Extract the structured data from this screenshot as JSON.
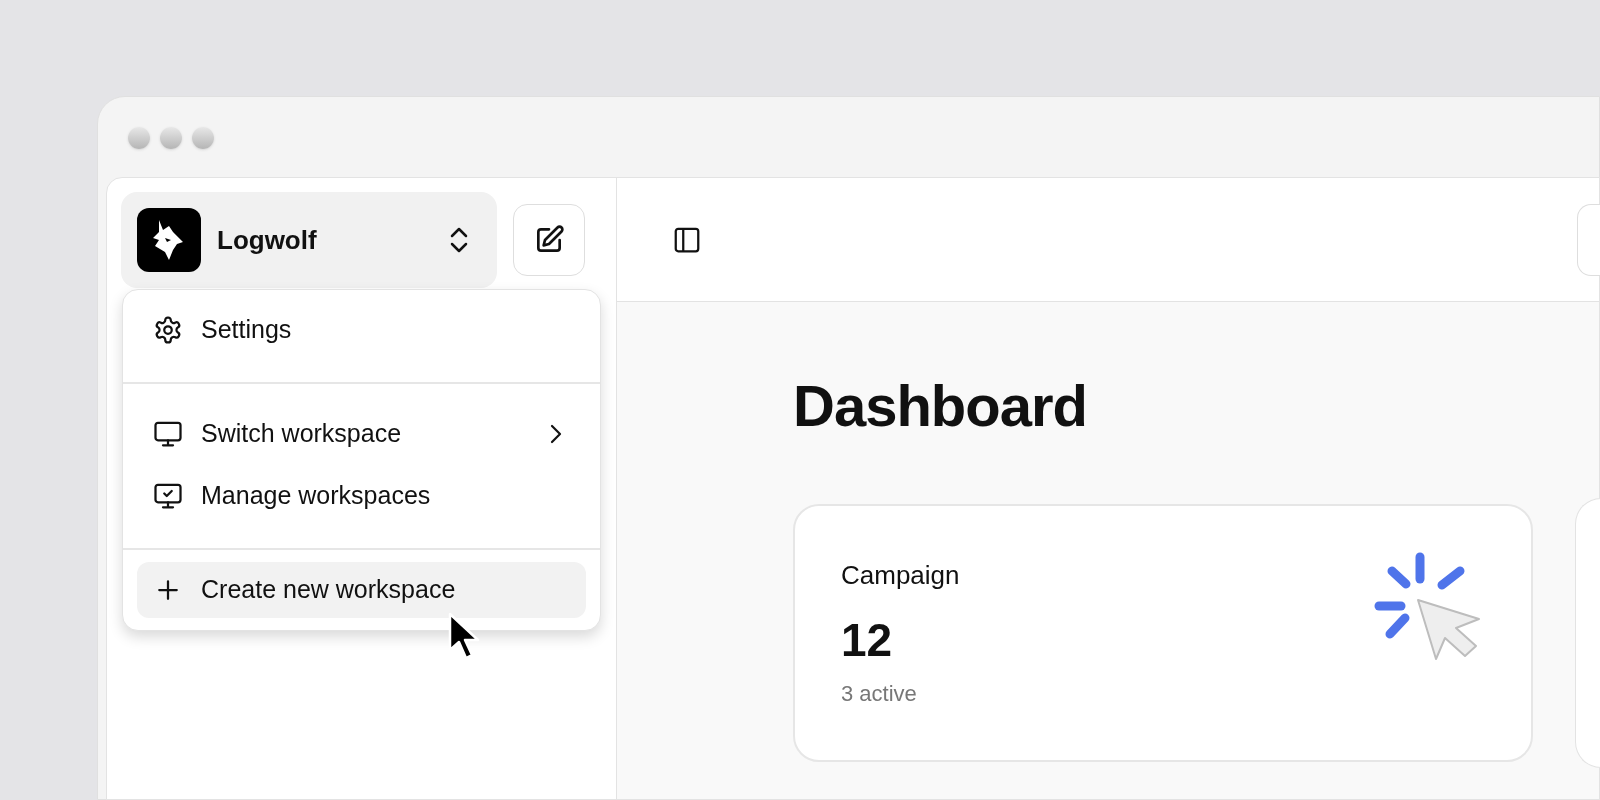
{
  "workspace": {
    "name": "Logwolf"
  },
  "menu": {
    "sections": [
      [
        {
          "label": "Settings",
          "submenu": false,
          "highlighted": false
        }
      ],
      [
        {
          "label": "Switch workspace",
          "submenu": true,
          "highlighted": false
        },
        {
          "label": "Manage workspaces",
          "submenu": false,
          "highlighted": false
        }
      ],
      [
        {
          "label": "Create new workspace",
          "submenu": false,
          "highlighted": true
        }
      ]
    ]
  },
  "main": {
    "title": "Dashboard",
    "cards": [
      {
        "title": "Campaign",
        "value": "12",
        "caption": "3 active"
      }
    ]
  }
}
